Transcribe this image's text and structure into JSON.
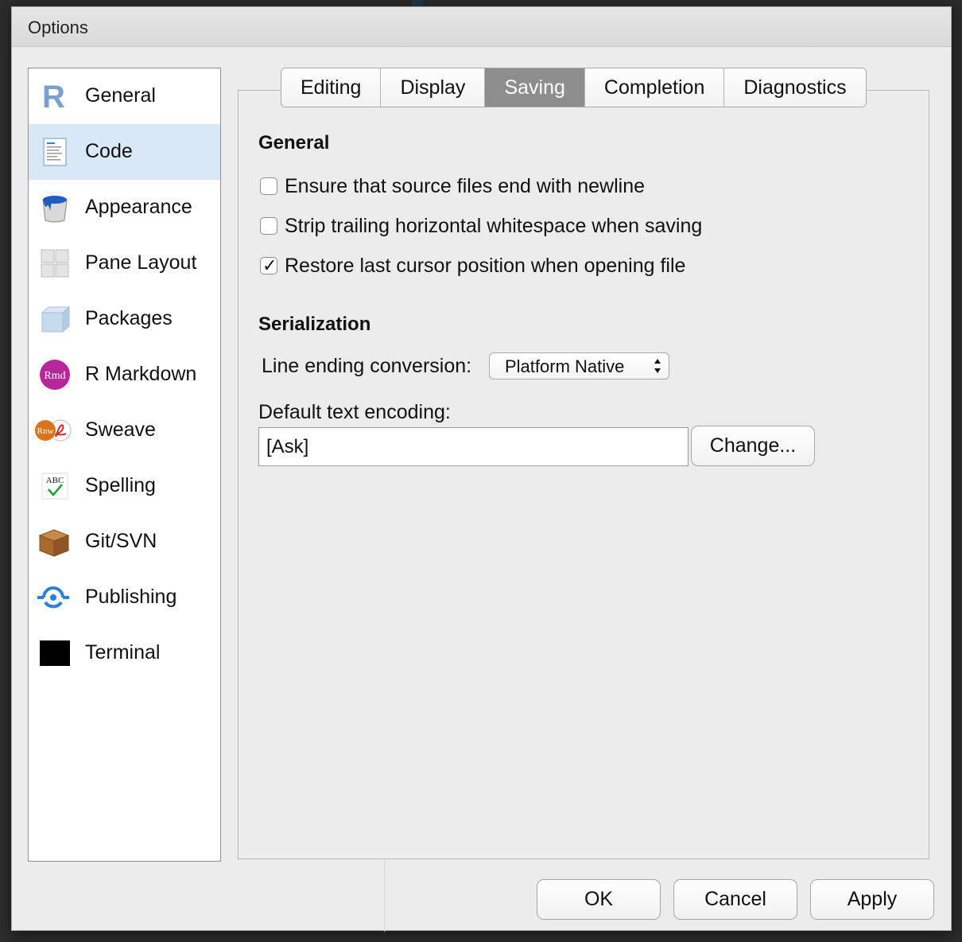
{
  "window": {
    "title": "Options"
  },
  "sidebar": {
    "items": [
      {
        "label": "General",
        "icon": "r-logo-icon",
        "selected": false
      },
      {
        "label": "Code",
        "icon": "code-document-icon",
        "selected": true
      },
      {
        "label": "Appearance",
        "icon": "paint-bucket-icon",
        "selected": false
      },
      {
        "label": "Pane Layout",
        "icon": "pane-grid-icon",
        "selected": false
      },
      {
        "label": "Packages",
        "icon": "package-cube-icon",
        "selected": false
      },
      {
        "label": "R Markdown",
        "icon": "rmd-icon",
        "selected": false
      },
      {
        "label": "Sweave",
        "icon": "sweave-pdf-icon",
        "selected": false
      },
      {
        "label": "Spelling",
        "icon": "spellcheck-icon",
        "selected": false
      },
      {
        "label": "Git/SVN",
        "icon": "cardboard-box-icon",
        "selected": false
      },
      {
        "label": "Publishing",
        "icon": "publish-icon",
        "selected": false
      },
      {
        "label": "Terminal",
        "icon": "terminal-icon",
        "selected": false
      }
    ],
    "icons": {
      "rmd_text": "Rmd",
      "rnw_text": "Rnw",
      "abc_text": "ABC"
    }
  },
  "tabs": [
    {
      "label": "Editing",
      "active": false
    },
    {
      "label": "Display",
      "active": false
    },
    {
      "label": "Saving",
      "active": true
    },
    {
      "label": "Completion",
      "active": false
    },
    {
      "label": "Diagnostics",
      "active": false
    }
  ],
  "general": {
    "title": "General",
    "options": [
      {
        "label": "Ensure that source files end with newline",
        "checked": false
      },
      {
        "label": "Strip trailing horizontal whitespace when saving",
        "checked": false
      },
      {
        "label": "Restore last cursor position when opening file",
        "checked": true
      }
    ]
  },
  "serialization": {
    "title": "Serialization",
    "line_ending_label": "Line ending conversion:",
    "line_ending_value": "Platform Native",
    "encoding_label": "Default text encoding:",
    "encoding_value": "[Ask]",
    "change_button": "Change..."
  },
  "footer": {
    "ok": "OK",
    "cancel": "Cancel",
    "apply": "Apply"
  },
  "colors": {
    "selected_bg": "#d8e8f7",
    "active_tab": "#8d8d8d",
    "publishing_blue": "#2f7fd8",
    "rmd_purple": "#b6279c"
  }
}
